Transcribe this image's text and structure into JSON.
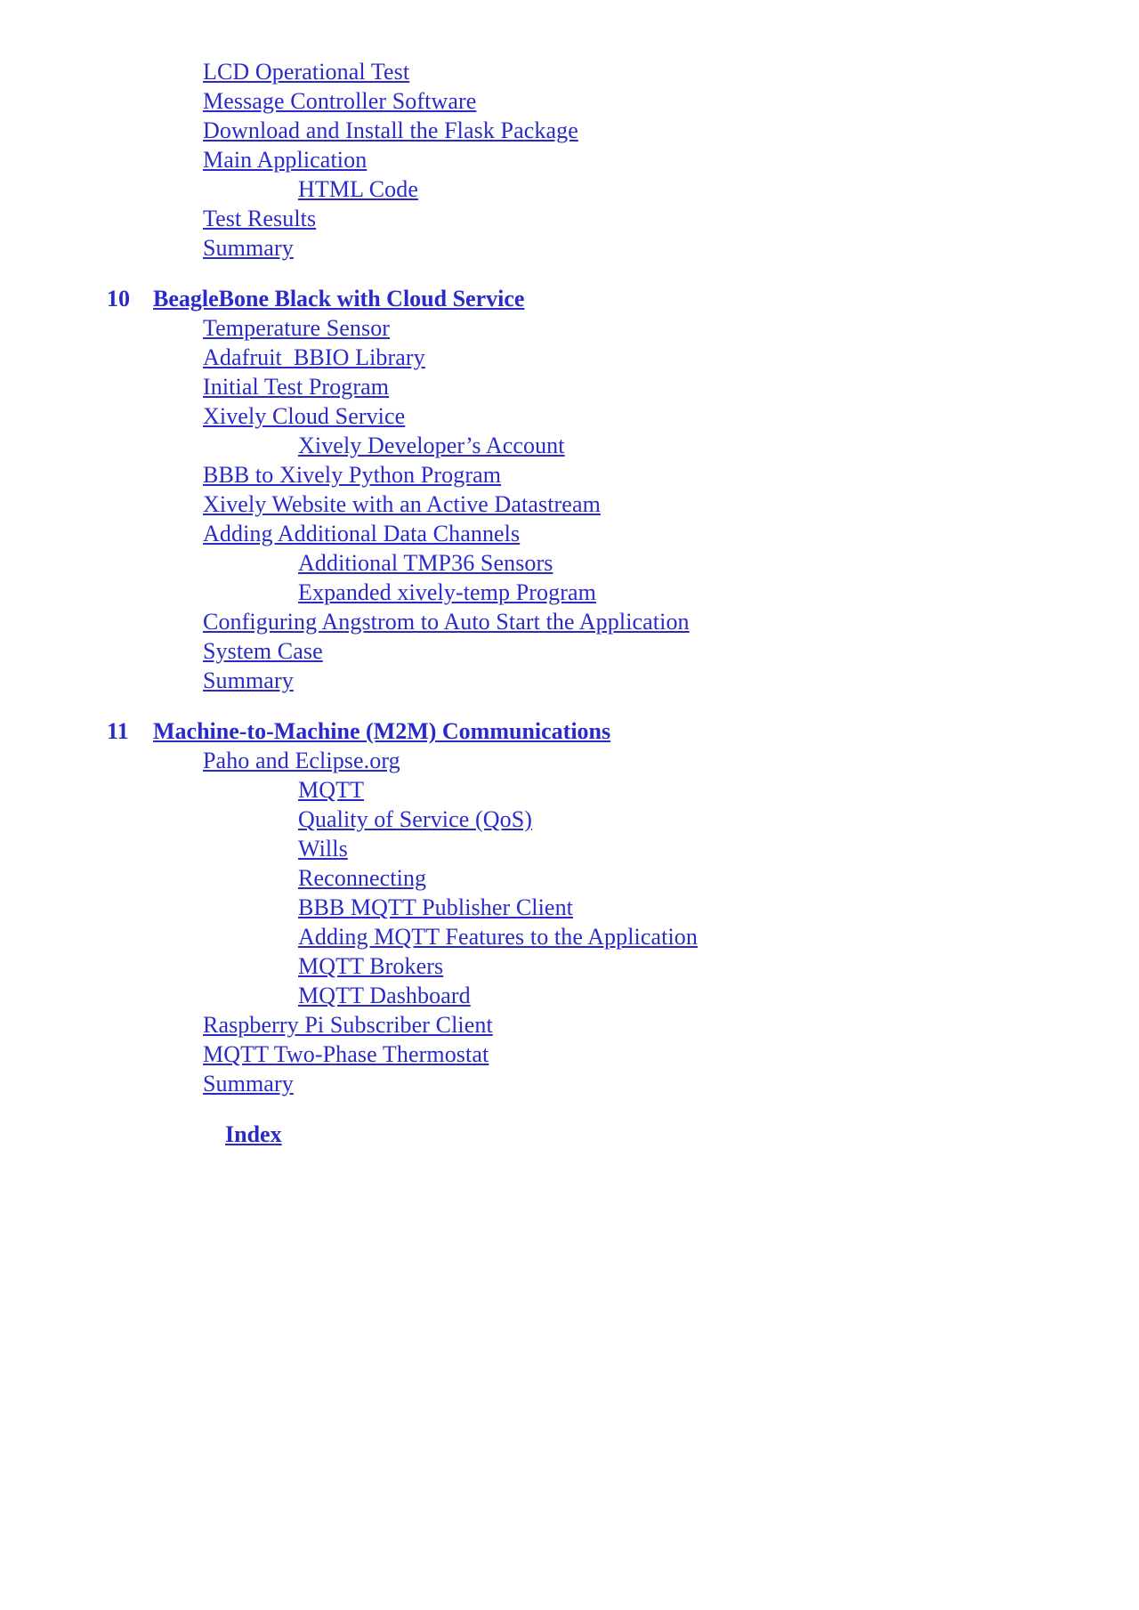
{
  "document": {
    "type": "table-of-contents",
    "link_color": "#2a2ac8",
    "page_background": "#ffffff"
  },
  "toc": {
    "entries": [
      {
        "level": 1,
        "text": "LCD Operational Test"
      },
      {
        "level": 1,
        "text": "Message Controller Software"
      },
      {
        "level": 1,
        "text": "Download and Install the Flask Package"
      },
      {
        "level": 1,
        "text": "Main Application"
      },
      {
        "level": 2,
        "text": "HTML Code"
      },
      {
        "level": 1,
        "text": "Test Results"
      },
      {
        "level": 1,
        "text": "Summary"
      },
      {
        "level": 0,
        "number": "10",
        "text": "BeagleBone Black with Cloud Service"
      },
      {
        "level": 1,
        "text": "Temperature Sensor"
      },
      {
        "level": 1,
        "text": "Adafruit_BBIO Library"
      },
      {
        "level": 1,
        "text": "Initial Test Program"
      },
      {
        "level": 1,
        "text": "Xively Cloud Service"
      },
      {
        "level": 2,
        "text": "Xively Developer’s Account"
      },
      {
        "level": 1,
        "text": "BBB to Xively Python Program"
      },
      {
        "level": 1,
        "text": "Xively Website with an Active Datastream"
      },
      {
        "level": 1,
        "text": "Adding Additional Data Channels"
      },
      {
        "level": 2,
        "text": "Additional TMP36 Sensors"
      },
      {
        "level": 2,
        "text": "Expanded xively-temp Program"
      },
      {
        "level": 1,
        "text": "Configuring Angstrom to Auto Start the Application"
      },
      {
        "level": 1,
        "text": "System Case"
      },
      {
        "level": 1,
        "text": "Summary"
      },
      {
        "level": 0,
        "number": "11",
        "text": "Machine-to-Machine (M2M) Communications"
      },
      {
        "level": 1,
        "text": "Paho and Eclipse.org"
      },
      {
        "level": 2,
        "text": "MQTT"
      },
      {
        "level": 2,
        "text": "Quality of Service (QoS)"
      },
      {
        "level": 2,
        "text": "Wills"
      },
      {
        "level": 2,
        "text": "Reconnecting"
      },
      {
        "level": 2,
        "text": "BBB MQTT Publisher Client"
      },
      {
        "level": 2,
        "text": "Adding MQTT Features to the Application"
      },
      {
        "level": 2,
        "text": "MQTT Brokers"
      },
      {
        "level": 2,
        "text": "MQTT Dashboard"
      },
      {
        "level": 1,
        "text": "Raspberry Pi Subscriber Client"
      },
      {
        "level": 1,
        "text": "MQTT Two-Phase Thermostat"
      },
      {
        "level": 1,
        "text": "Summary"
      },
      {
        "level": -1,
        "text": "Index"
      }
    ]
  }
}
